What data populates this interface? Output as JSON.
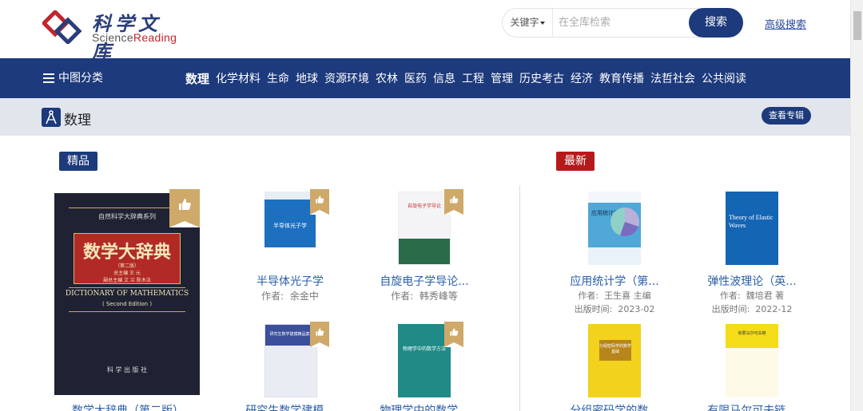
{
  "header": {
    "logo_cn": "科学文库",
    "logo_en_pre": "Science",
    "logo_en_post": "Reading",
    "search_type": "关键字",
    "search_placeholder": "在全库检索",
    "search_button": "搜索",
    "advanced_search": "高级搜索"
  },
  "nav": {
    "category_label": "中图分类",
    "items": [
      "数理",
      "化学材料",
      "生命",
      "地球",
      "资源环境",
      "农林",
      "医药",
      "信息",
      "工程",
      "管理",
      "历史考古",
      "经济",
      "教育传播",
      "法哲社会",
      "公共阅读"
    ]
  },
  "subject": {
    "title": "数理",
    "view_topic": "查看专辑"
  },
  "sections": {
    "featured": "精品",
    "latest": "最新"
  },
  "featured_books": [
    {
      "title": "数学大辞典（第二版）",
      "cover": {
        "series": "自然科学大辞典系列",
        "cn_title": "数学大辞典",
        "edition": "（第二版）",
        "editors": "总主编 王 元",
        "editors2": "副总主编 文 兰 陈木法",
        "en_title": "DICTIONARY OF MATHEMATICS",
        "en_edition": "( Second Edition )",
        "publisher": "科 学 出 版 社"
      }
    },
    {
      "title": "半导体光子学",
      "author_label": "作者:",
      "author": "余金中",
      "cover_text": "半导体光子学"
    },
    {
      "title": "自旋电子学导论...",
      "author_label": "作者:",
      "author": "韩秀峰等",
      "cover_text": "自旋电子学导论"
    },
    {
      "title": "研究生数学建模...",
      "cover_text": "研究生数学建模精品案例"
    },
    {
      "title": "物理学中的数学...",
      "cover_text": "物理学中的数学方法"
    }
  ],
  "latest_books": [
    {
      "title": "应用统计学（第...",
      "author_label": "作者:",
      "author": "王生喜 主编",
      "date_label": "出版时间:",
      "date": "2023-02",
      "cover_text": "应用统计学"
    },
    {
      "title": "弹性波理论（英...",
      "author_label": "作者:",
      "author": "魏培君 著",
      "date_label": "出版时间:",
      "date": "2022-12",
      "cover_text": "Theory of Elastic Waves"
    },
    {
      "title": "分组密码学的数...",
      "cover_text": "分组密码学的数学基础"
    },
    {
      "title": "有限马尔可夫链...",
      "cover_text": "有限马尔可夫链"
    }
  ],
  "colors": {
    "primary": "#1c3a7c",
    "accent_red": "#b6191c",
    "link": "#2a5fa8",
    "thumb_gold": "#cfa96a"
  }
}
